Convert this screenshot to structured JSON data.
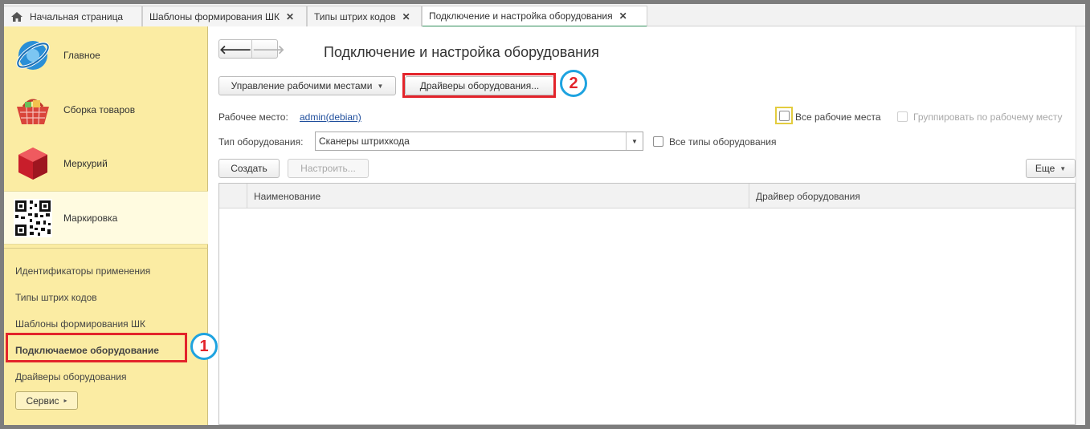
{
  "tabs": [
    {
      "label": "Начальная страница",
      "icon": "home-icon"
    },
    {
      "label": "Шаблоны формирования ШК"
    },
    {
      "label": "Типы штрих кодов"
    },
    {
      "label": "Подключение и настройка оборудования"
    }
  ],
  "sidebar": {
    "sections": [
      {
        "label": "Главное",
        "icon": "main-section-icon"
      },
      {
        "label": "Сборка товаров",
        "icon": "basket-icon"
      },
      {
        "label": "Меркурий",
        "icon": "cube-icon"
      },
      {
        "label": "Маркировка",
        "icon": "qr-code-icon"
      }
    ],
    "links": [
      {
        "label": "Идентификаторы применения"
      },
      {
        "label": "Типы штрих кодов"
      },
      {
        "label": "Шаблоны формирования ШК"
      },
      {
        "label": "Подключаемое оборудование"
      },
      {
        "label": "Драйверы оборудования"
      }
    ],
    "service_label": "Сервис"
  },
  "main": {
    "title": "Подключение и настройка оборудования",
    "manage_label": "Управление рабочими местами",
    "drivers_label": "Драйверы оборудования...",
    "workplace_label": "Рабочее место:",
    "workplace_value": "admin(debian)",
    "all_workplaces_label": "Все рабочие места",
    "group_label": "Группировать по рабочему месту",
    "equip_type_label": "Тип оборудования:",
    "equip_type_value": "Сканеры штрихкода",
    "all_types_label": "Все типы оборудования",
    "create_label": "Создать",
    "configure_label": "Настроить...",
    "more_label": "Еще",
    "columns": [
      "Наименование",
      "Драйвер оборудования"
    ]
  },
  "annotations": {
    "badge1": "1",
    "badge2": "2",
    "highlight_color": "#e3242b",
    "badge_ring_color": "#1ea3e0"
  },
  "colors": {
    "sidebar_bg": "#fbeca3",
    "active_tab_underline": "#2f8f5a",
    "link": "#1f4e9c"
  }
}
